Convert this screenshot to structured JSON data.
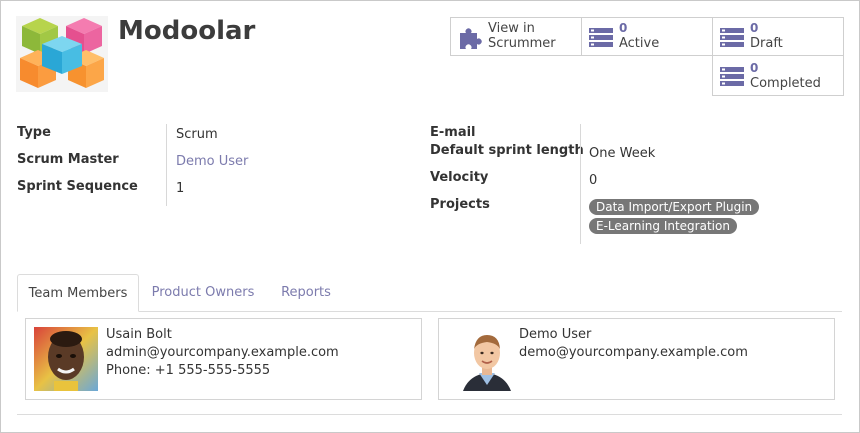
{
  "team": {
    "name": "Modoolar"
  },
  "stats": {
    "scrummer": {
      "line1": "View in",
      "line2": "Scrummer"
    },
    "active": {
      "count": "0",
      "label": "Active"
    },
    "draft": {
      "count": "0",
      "label": "Draft"
    },
    "completed": {
      "count": "0",
      "label": "Completed"
    }
  },
  "fields_left": {
    "type": {
      "label": "Type",
      "value": "Scrum"
    },
    "scrum_master": {
      "label": "Scrum Master",
      "value": "Demo User"
    },
    "sprint_sequence": {
      "label": "Sprint Sequence",
      "value": "1"
    }
  },
  "fields_right": {
    "email": {
      "label": "E-mail",
      "value": ""
    },
    "sprint_length": {
      "label": "Default sprint length",
      "value": "One Week"
    },
    "velocity": {
      "label": "Velocity",
      "value": "0"
    },
    "projects": {
      "label": "Projects",
      "tags": [
        "Data Import/Export Plugin",
        "E-Learning Integration"
      ]
    }
  },
  "tabs": [
    {
      "label": "Team Members",
      "active": true
    },
    {
      "label": "Product Owners",
      "active": false
    },
    {
      "label": "Reports",
      "active": false
    }
  ],
  "members": [
    {
      "name": "Usain Bolt",
      "email": "admin@yourcompany.example.com",
      "phone": "Phone: +1 555-555-5555"
    },
    {
      "name": "Demo User",
      "email": "demo@yourcompany.example.com"
    }
  ],
  "colors": {
    "link": "#7c7bad",
    "tag_bg": "#777777",
    "stat_number": "#6b6aa6"
  }
}
